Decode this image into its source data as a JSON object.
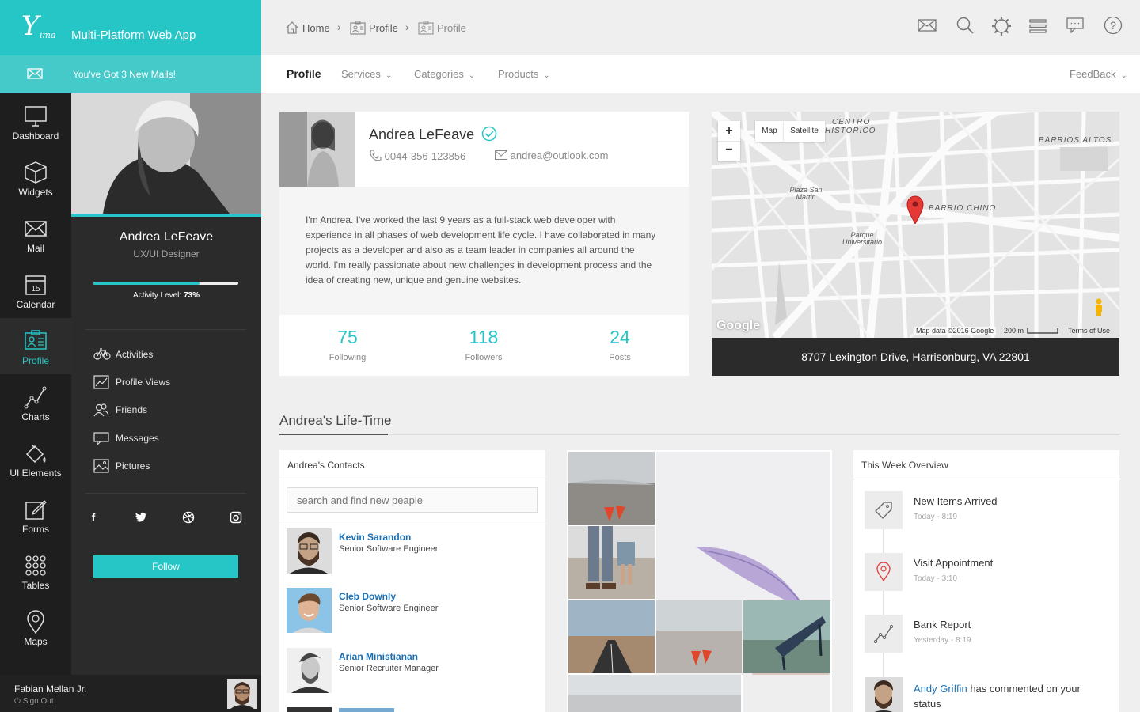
{
  "brand": {
    "logo_main": "Y",
    "logo_sub": "ima",
    "app_title": "Multi-Platform Web App"
  },
  "mailbar": {
    "text": "You've Got 3 New Mails!"
  },
  "nav": [
    {
      "label": "Dashboard",
      "icon": "monitor-icon"
    },
    {
      "label": "Widgets",
      "icon": "cube-icon"
    },
    {
      "label": "Mail",
      "icon": "envelope-icon"
    },
    {
      "label": "Calendar",
      "icon": "calendar-icon",
      "badge": "15"
    },
    {
      "label": "Profile",
      "icon": "profile-card-icon",
      "active": true
    },
    {
      "label": "Charts",
      "icon": "line-chart-icon"
    },
    {
      "label": "UI Elements",
      "icon": "paint-bucket-icon"
    },
    {
      "label": "Forms",
      "icon": "edit-icon"
    },
    {
      "label": "Tables",
      "icon": "grid-dots-icon"
    },
    {
      "label": "Maps",
      "icon": "map-pin-icon"
    }
  ],
  "profile_panel": {
    "name": "Andrea LeFeave",
    "role": "UX/UI Designer",
    "activity_label": "Activity Level:",
    "activity_value": "73%",
    "activity_fraction": 0.73,
    "menu": [
      "Activities",
      "Profile Views",
      "Friends",
      "Messages",
      "Pictures"
    ],
    "social": [
      "facebook-icon",
      "twitter-icon",
      "dribbble-icon",
      "instagram-icon"
    ],
    "follow_label": "Follow"
  },
  "user": {
    "name": "Fabian Mellan Jr.",
    "signout": "Sign Out"
  },
  "breadcrumb": [
    "Home",
    "Profile",
    "Profile"
  ],
  "tabs": [
    {
      "label": "Profile",
      "active": true
    },
    {
      "label": "Services"
    },
    {
      "label": "Categories"
    },
    {
      "label": "Products"
    }
  ],
  "feedback_label": "FeedBack",
  "profile_card": {
    "name": "Andrea LeFeave",
    "phone": "0044-356-123856",
    "email": "andrea@outlook.com",
    "bio": "I'm Andrea. I've worked the last 9 years as a full-stack web developer with experience in all phases of web development life cycle. I have collaborated in many projects as a developer and also as a team leader in companies all around the world. I'm really passionate about new challenges in development process and the idea of creating new, unique and genuine websites.",
    "stats": [
      {
        "value": "75",
        "label": "Following"
      },
      {
        "value": "118",
        "label": "Followers"
      },
      {
        "value": "24",
        "label": "Posts"
      }
    ]
  },
  "map": {
    "zoom_in": "+",
    "zoom_out": "−",
    "type_map": "Map",
    "type_satellite": "Satellite",
    "labels": {
      "centro_1": "CENTRO",
      "centro_2": "HISTORICO",
      "barrios_altos": "BARRIOS ALTOS",
      "barrio_chino": "BARRIO CHINO",
      "plaza_1": "Plaza San",
      "plaza_2": "Martin",
      "parque_1": "Parque",
      "parque_2": "Universitario"
    },
    "google": "Google",
    "map_data": "Map data ©2016 Google",
    "scale": "200 m",
    "terms": "Terms of Use",
    "address": "8707 Lexington Drive, Harrisonburg, VA 22801"
  },
  "lifetime": {
    "title": "Andrea's Life-Time"
  },
  "contacts": {
    "title": "Andrea's Contacts",
    "search_placeholder": "search and find new peaple",
    "items": [
      {
        "name": "Kevin Sarandon",
        "role": "Senior Software Engineer"
      },
      {
        "name": "Cleb Downly",
        "role": "Senior Software Engineer"
      },
      {
        "name": "Arian Ministianan",
        "role": "Senior Recruiter Manager"
      }
    ]
  },
  "week": {
    "title": "This Week Overview",
    "items": [
      {
        "title": "New Items Arrived",
        "date": "Today - 8:19",
        "icon": "tag-icon"
      },
      {
        "title": "Visit Appointment",
        "date": "Today - 3:10",
        "icon": "location-pin-icon"
      },
      {
        "title": "Bank Report",
        "date": "Yesterday - 8:19",
        "icon": "line-chart-icon"
      },
      {
        "title_name": "Andy Griffin",
        "title_rest": "has commented on your status",
        "icon": "avatar"
      }
    ]
  },
  "colors": {
    "accent": "#26c6c7",
    "dark": "#1e1e1e",
    "link": "#1a6fb4"
  }
}
